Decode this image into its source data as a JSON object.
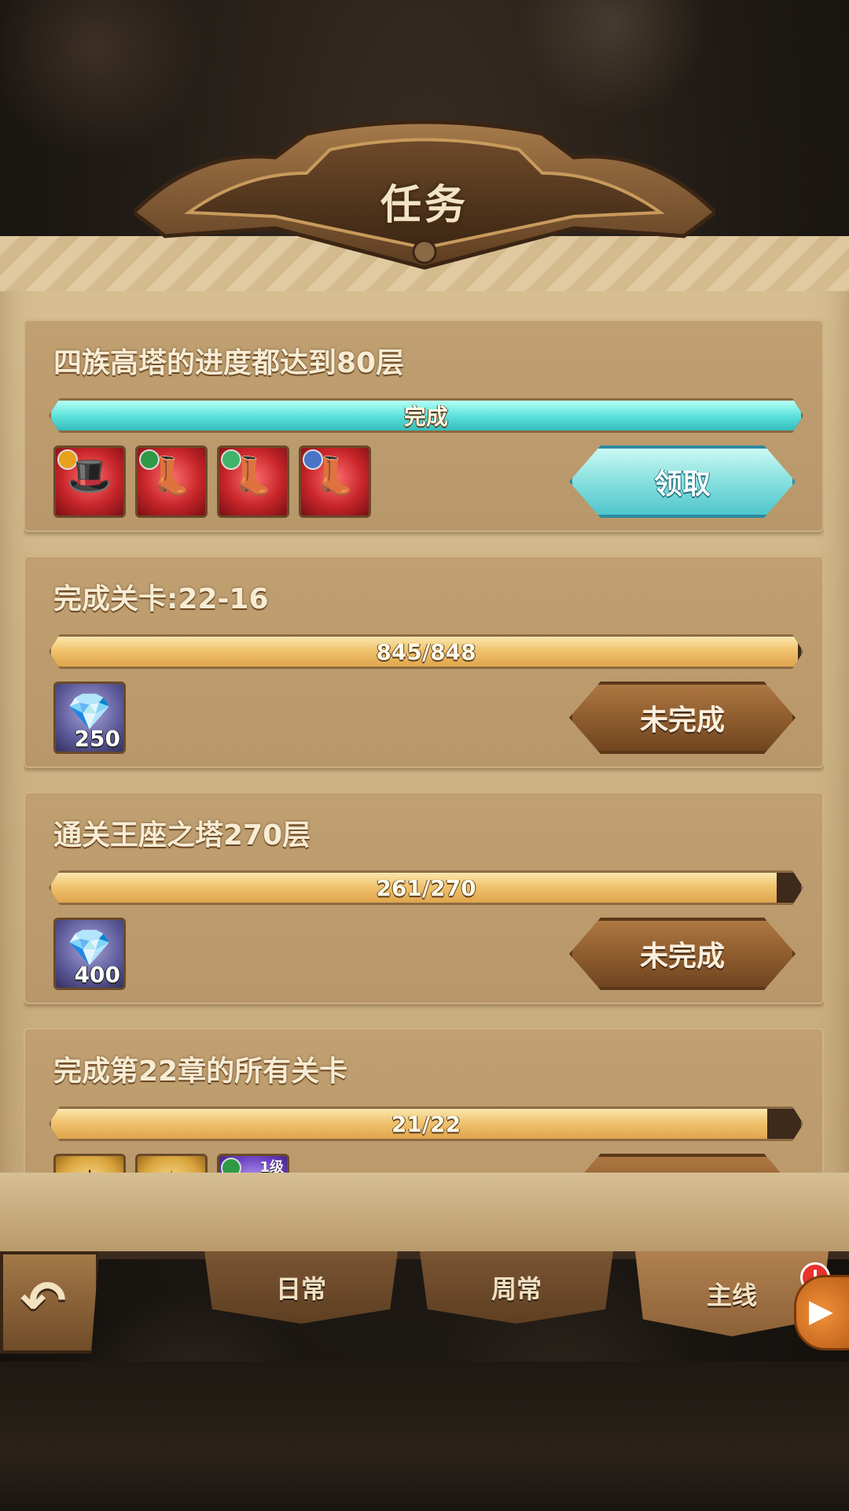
{
  "header": {
    "title": "任务"
  },
  "quests": [
    {
      "title": "四族高塔的进度都达到80层",
      "progress_text": "完成",
      "progress_fraction": 1.0,
      "completed": true,
      "button_label": "领取",
      "rewards": [
        {
          "icon": "hero-hat-icon",
          "qty": ""
        },
        {
          "icon": "boots-icon",
          "qty": ""
        },
        {
          "icon": "boots-icon",
          "qty": ""
        },
        {
          "icon": "boots-icon",
          "qty": ""
        }
      ]
    },
    {
      "title": "完成关卡:22-16",
      "progress_text": "845/848",
      "progress_fraction": 0.996,
      "completed": false,
      "button_label": "未完成",
      "rewards": [
        {
          "icon": "diamond-icon",
          "qty": "250"
        }
      ]
    },
    {
      "title": "通关王座之塔270层",
      "progress_text": "261/270",
      "progress_fraction": 0.967,
      "completed": false,
      "button_label": "未完成",
      "rewards": [
        {
          "icon": "diamond-icon",
          "qty": "400"
        }
      ]
    },
    {
      "title": "完成第22章的所有关卡",
      "progress_text": "21/22",
      "progress_fraction": 0.955,
      "completed": false,
      "button_label": "",
      "rewards": [
        {
          "icon": "gold-medal-icon",
          "qty": ""
        },
        {
          "icon": "scroll-icon",
          "qty": ""
        },
        {
          "icon": "hero-card-icon",
          "qty": "",
          "level": "1级"
        }
      ]
    }
  ],
  "tabs": [
    {
      "label": "日常",
      "active": false
    },
    {
      "label": "周常",
      "active": false
    },
    {
      "label": "主线",
      "active": true,
      "badge": "!"
    }
  ],
  "colors": {
    "claim_accent": "#4cc3cb",
    "progress_gold": "#f0c36f",
    "progress_done": "#5ee3dc",
    "pending_button": "#8c5a2c",
    "parchment": "#cfb587"
  }
}
